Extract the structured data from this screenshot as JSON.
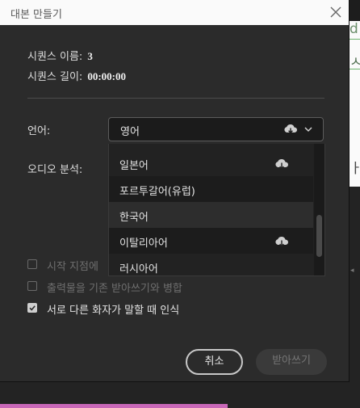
{
  "dialog": {
    "title": "대본 만들기",
    "sequence_name_label": "시퀀스 이름:",
    "sequence_name_value": "3",
    "sequence_length_label": "시퀀스 길이:",
    "sequence_length_value": "00:00:00",
    "language_label": "언어:",
    "audio_analysis_label": "오디오 분석:",
    "language_select": {
      "selected": "영어",
      "icons": [
        "cloud-download-icon",
        "chevron-down-icon"
      ]
    },
    "language_options": [
      {
        "label": "일본어",
        "icon": "cloud-download-icon"
      },
      {
        "label": "포르투갈어(유럽)",
        "icon": ""
      },
      {
        "label": "한국어",
        "icon": ""
      },
      {
        "label": "이탈리아어",
        "icon": "cloud-download-icon"
      },
      {
        "label": "러시아어",
        "icon": ""
      }
    ],
    "checkboxes": [
      {
        "label": "시작 지점에",
        "checked": false,
        "enabled": false
      },
      {
        "label": "출력물을 기존 받아쓰기와 병합",
        "checked": false,
        "enabled": false
      },
      {
        "label": "서로 다른 화자가 말할 때 인식",
        "checked": true,
        "enabled": true
      }
    ],
    "buttons": {
      "cancel": "취소",
      "transcribe": "받아쓰기"
    }
  },
  "background": {
    "right_fragments": [
      "d",
      "ㅅ",
      "ㅏ",
      "ㅜ"
    ]
  },
  "colors": {
    "dialog_bg": "#2b2b2b",
    "titlebar_bg": "#fafafa",
    "timeline_marker": "#c968b8"
  }
}
